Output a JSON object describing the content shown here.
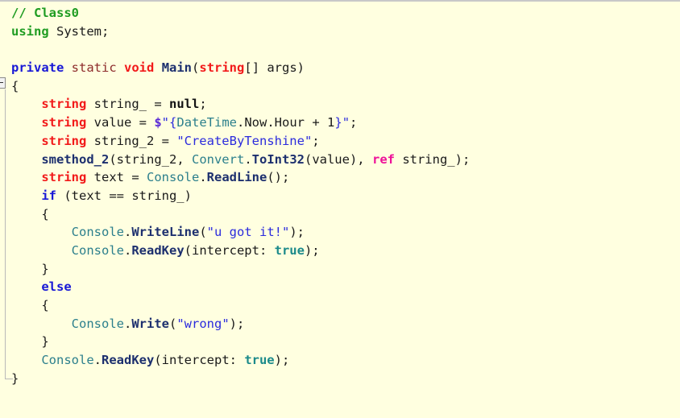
{
  "editor": {
    "language": "csharp",
    "background_color": "#FFFFE0",
    "gutter": {
      "fold_toggle_label": "collapse-block",
      "fold_state": "expanded"
    },
    "colors": {
      "comment": "#1F9C22",
      "keyword": "#1818D6",
      "modifier": "#8D2B2B",
      "type": "#F21A1A",
      "method": "#1C2F6E",
      "class": "#2B7F8C",
      "string": "#2B2BDD",
      "constant": "#1B8A8A",
      "ref_keyword": "#EE1199",
      "plain": "#1A1A1A"
    }
  },
  "code": {
    "lines": [
      {
        "index": 1,
        "text": "// Class0",
        "tokens": [
          {
            "s": "// Class0",
            "c": "t-comment"
          }
        ]
      },
      {
        "index": 2,
        "text": "using System;",
        "tokens": [
          {
            "s": "using",
            "c": "t-using"
          },
          {
            "s": " ",
            "c": "t-plain"
          },
          {
            "s": "System;",
            "c": "t-plain"
          }
        ]
      },
      {
        "index": 3,
        "text": "",
        "tokens": []
      },
      {
        "index": 4,
        "text": "private static void Main(string[] args)",
        "tokens": [
          {
            "s": "private",
            "c": "t-kw"
          },
          {
            "s": " ",
            "c": "t-plain"
          },
          {
            "s": "static",
            "c": "t-mod"
          },
          {
            "s": " ",
            "c": "t-plain"
          },
          {
            "s": "void",
            "c": "t-type"
          },
          {
            "s": " ",
            "c": "t-plain"
          },
          {
            "s": "Main",
            "c": "t-method"
          },
          {
            "s": "(",
            "c": "t-plain"
          },
          {
            "s": "string",
            "c": "t-type"
          },
          {
            "s": "[] args)",
            "c": "t-plain"
          }
        ]
      },
      {
        "index": 5,
        "text": "{",
        "tokens": [
          {
            "s": "{",
            "c": "t-plain"
          }
        ]
      },
      {
        "index": 6,
        "text": "    string string_ = null;",
        "tokens": [
          {
            "s": "    ",
            "c": "t-plain"
          },
          {
            "s": "string",
            "c": "t-type"
          },
          {
            "s": " string_ = ",
            "c": "t-plain"
          },
          {
            "s": "null",
            "c": "t-null"
          },
          {
            "s": ";",
            "c": "t-plain"
          }
        ]
      },
      {
        "index": 7,
        "text": "    string value = $\"{DateTime.Now.Hour + 1}\";",
        "tokens": [
          {
            "s": "    ",
            "c": "t-plain"
          },
          {
            "s": "string",
            "c": "t-type"
          },
          {
            "s": " value = ",
            "c": "t-plain"
          },
          {
            "s": "$",
            "c": "t-interp"
          },
          {
            "s": "\"",
            "c": "t-str"
          },
          {
            "s": "{",
            "c": "t-str"
          },
          {
            "s": "DateTime",
            "c": "t-class"
          },
          {
            "s": ".Now.Hour + ",
            "c": "t-plain"
          },
          {
            "s": "1",
            "c": "t-num"
          },
          {
            "s": "}",
            "c": "t-str"
          },
          {
            "s": "\"",
            "c": "t-str"
          },
          {
            "s": ";",
            "c": "t-plain"
          }
        ]
      },
      {
        "index": 8,
        "text": "    string string_2 = \"CreateByTenshine\";",
        "tokens": [
          {
            "s": "    ",
            "c": "t-plain"
          },
          {
            "s": "string",
            "c": "t-type"
          },
          {
            "s": " string_2 = ",
            "c": "t-plain"
          },
          {
            "s": "\"CreateByTenshine\"",
            "c": "t-str"
          },
          {
            "s": ";",
            "c": "t-plain"
          }
        ]
      },
      {
        "index": 9,
        "text": "    smethod_2(string_2, Convert.ToInt32(value), ref string_);",
        "tokens": [
          {
            "s": "    ",
            "c": "t-plain"
          },
          {
            "s": "smethod_2",
            "c": "t-method"
          },
          {
            "s": "(string_2, ",
            "c": "t-plain"
          },
          {
            "s": "Convert",
            "c": "t-class"
          },
          {
            "s": ".",
            "c": "t-plain"
          },
          {
            "s": "ToInt32",
            "c": "t-method"
          },
          {
            "s": "(value), ",
            "c": "t-plain"
          },
          {
            "s": "ref",
            "c": "t-ref"
          },
          {
            "s": " string_);",
            "c": "t-plain"
          }
        ]
      },
      {
        "index": 10,
        "text": "    string text = Console.ReadLine();",
        "tokens": [
          {
            "s": "    ",
            "c": "t-plain"
          },
          {
            "s": "string",
            "c": "t-type"
          },
          {
            "s": " text = ",
            "c": "t-plain"
          },
          {
            "s": "Console",
            "c": "t-class"
          },
          {
            "s": ".",
            "c": "t-plain"
          },
          {
            "s": "ReadLine",
            "c": "t-method"
          },
          {
            "s": "();",
            "c": "t-plain"
          }
        ]
      },
      {
        "index": 11,
        "text": "    if (text == string_)",
        "tokens": [
          {
            "s": "    ",
            "c": "t-plain"
          },
          {
            "s": "if",
            "c": "t-kw"
          },
          {
            "s": " (text == string_)",
            "c": "t-plain"
          }
        ]
      },
      {
        "index": 12,
        "text": "    {",
        "tokens": [
          {
            "s": "    {",
            "c": "t-plain"
          }
        ]
      },
      {
        "index": 13,
        "text": "        Console.WriteLine(\"u got it!\");",
        "tokens": [
          {
            "s": "        ",
            "c": "t-plain"
          },
          {
            "s": "Console",
            "c": "t-class"
          },
          {
            "s": ".",
            "c": "t-plain"
          },
          {
            "s": "WriteLine",
            "c": "t-method"
          },
          {
            "s": "(",
            "c": "t-plain"
          },
          {
            "s": "\"u got it!\"",
            "c": "t-str"
          },
          {
            "s": ");",
            "c": "t-plain"
          }
        ]
      },
      {
        "index": 14,
        "text": "        Console.ReadKey(intercept: true);",
        "tokens": [
          {
            "s": "        ",
            "c": "t-plain"
          },
          {
            "s": "Console",
            "c": "t-class"
          },
          {
            "s": ".",
            "c": "t-plain"
          },
          {
            "s": "ReadKey",
            "c": "t-method"
          },
          {
            "s": "(intercept: ",
            "c": "t-plain"
          },
          {
            "s": "true",
            "c": "t-const"
          },
          {
            "s": ");",
            "c": "t-plain"
          }
        ]
      },
      {
        "index": 15,
        "text": "    }",
        "tokens": [
          {
            "s": "    }",
            "c": "t-plain"
          }
        ]
      },
      {
        "index": 16,
        "text": "    else",
        "tokens": [
          {
            "s": "    ",
            "c": "t-plain"
          },
          {
            "s": "else",
            "c": "t-kw"
          }
        ]
      },
      {
        "index": 17,
        "text": "    {",
        "tokens": [
          {
            "s": "    {",
            "c": "t-plain"
          }
        ]
      },
      {
        "index": 18,
        "text": "        Console.Write(\"wrong\");",
        "tokens": [
          {
            "s": "        ",
            "c": "t-plain"
          },
          {
            "s": "Console",
            "c": "t-class"
          },
          {
            "s": ".",
            "c": "t-plain"
          },
          {
            "s": "Write",
            "c": "t-method"
          },
          {
            "s": "(",
            "c": "t-plain"
          },
          {
            "s": "\"wrong\"",
            "c": "t-str"
          },
          {
            "s": ");",
            "c": "t-plain"
          }
        ]
      },
      {
        "index": 19,
        "text": "    }",
        "tokens": [
          {
            "s": "    }",
            "c": "t-plain"
          }
        ]
      },
      {
        "index": 20,
        "text": "    Console.ReadKey(intercept: true);",
        "tokens": [
          {
            "s": "    ",
            "c": "t-plain"
          },
          {
            "s": "Console",
            "c": "t-class"
          },
          {
            "s": ".",
            "c": "t-plain"
          },
          {
            "s": "ReadKey",
            "c": "t-method"
          },
          {
            "s": "(intercept: ",
            "c": "t-plain"
          },
          {
            "s": "true",
            "c": "t-const"
          },
          {
            "s": ");",
            "c": "t-plain"
          }
        ]
      },
      {
        "index": 21,
        "text": "}",
        "tokens": [
          {
            "s": "}",
            "c": "t-plain"
          }
        ]
      }
    ]
  }
}
